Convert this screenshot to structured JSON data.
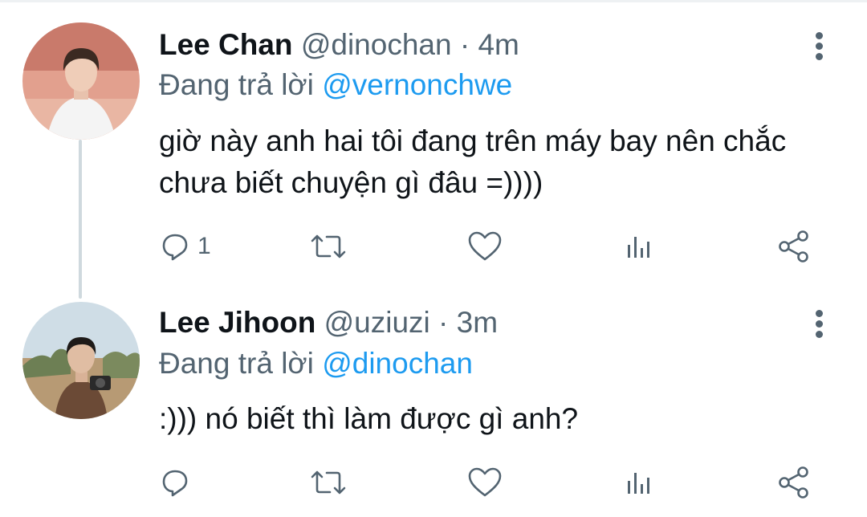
{
  "tweets": [
    {
      "name": "Lee Chan",
      "handle": "@dinochan",
      "separator": "·",
      "time": "4m",
      "reply_prefix": "Đang trả lời",
      "reply_to": "@vernonchwe",
      "text": "giờ này anh hai tôi đang trên máy bay nên chắc chưa biết chuyện gì đâu =))))",
      "reply_count": "1",
      "avatar_icon": "user-avatar-photo"
    },
    {
      "name": "Lee Jihoon",
      "handle": "@uziuzi",
      "separator": "·",
      "time": "3m",
      "reply_prefix": "Đang trả lời",
      "reply_to": "@dinochan",
      "text": ":))) nó biết thì làm được gì anh?",
      "reply_count": "",
      "avatar_icon": "user-avatar-photo"
    }
  ],
  "icons": [
    "reply-icon",
    "retweet-icon",
    "like-icon",
    "analytics-icon",
    "share-icon",
    "more-options-icon"
  ],
  "colors": {
    "text": "#0f1419",
    "secondary": "#536471",
    "accent": "#1d9bf0",
    "thread_line": "#cfd9de"
  }
}
